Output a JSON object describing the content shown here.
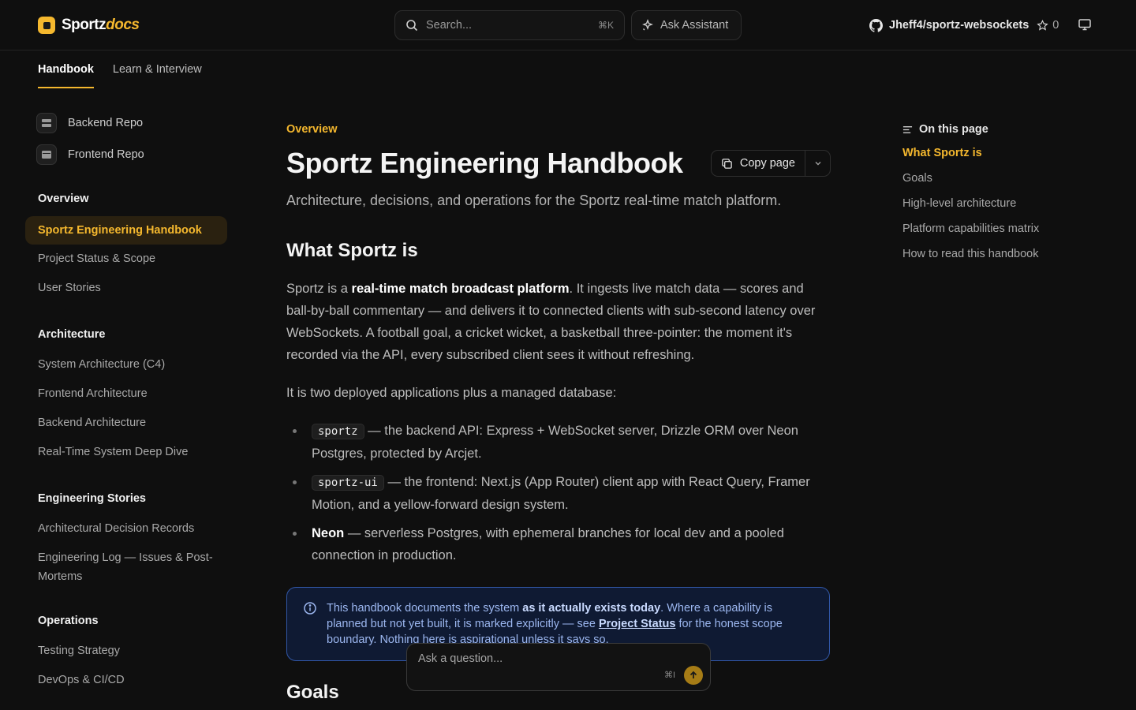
{
  "header": {
    "logo_text": "Sportz",
    "logo_accent": "docs",
    "search_placeholder": "Search...",
    "search_shortcut": "⌘K",
    "assistant_label": "Ask Assistant",
    "repo_name": "Jheff4/sportz-websockets",
    "repo_stars": "0"
  },
  "tabs": [
    {
      "label": "Handbook",
      "active": true
    },
    {
      "label": "Learn & Interview",
      "active": false
    }
  ],
  "sidebar": {
    "repos": [
      {
        "label": "Backend Repo"
      },
      {
        "label": "Frontend Repo"
      }
    ],
    "sections": [
      {
        "title": "Overview",
        "items": [
          "Sportz Engineering Handbook",
          "Project Status & Scope",
          "User Stories"
        ]
      },
      {
        "title": "Architecture",
        "items": [
          "System Architecture (C4)",
          "Frontend Architecture",
          "Backend Architecture",
          "Real-Time System Deep Dive"
        ]
      },
      {
        "title": "Engineering Stories",
        "items": [
          "Architectural Decision Records",
          "Engineering Log — Issues & Post-Mortems"
        ]
      },
      {
        "title": "Operations",
        "items": [
          "Testing Strategy",
          "DevOps & CI/CD"
        ]
      }
    ],
    "active_item": "Sportz Engineering Handbook"
  },
  "main": {
    "eyebrow": "Overview",
    "title": "Sportz Engineering Handbook",
    "copy_label": "Copy page",
    "subtitle": "Architecture, decisions, and operations for the Sportz real-time match platform.",
    "h2_what": "What Sportz is",
    "p1_a": "Sportz is a ",
    "p1_strong": "real-time match broadcast platform",
    "p1_b": ". It ingests live match data — scores and ball-by-ball commentary — and delivers it to connected clients with sub-second latency over WebSockets. A football goal, a cricket wicket, a basketball three-pointer: the moment it's recorded via the API, every subscribed client sees it without refreshing.",
    "p2": "It is two deployed applications plus a managed database:",
    "bullets": [
      {
        "code": "sportz",
        "text": " — the backend API: Express + WebSocket server, Drizzle ORM over Neon Postgres, protected by Arcjet."
      },
      {
        "code": "sportz-ui",
        "text": " — the frontend: Next.js (App Router) client app with React Query, Framer Motion, and a yellow-forward design system."
      },
      {
        "strong": "Neon",
        "text": " — serverless Postgres, with ephemeral branches for local dev and a pooled connection in production."
      }
    ],
    "callout": {
      "a": "This handbook documents the system ",
      "strong": "as it actually exists today",
      "b": ". Where a capability is planned but not yet built, it is marked explicitly — see ",
      "link": "Project Status",
      "c": " for the honest scope boundary. Nothing here is aspirational unless it says so."
    },
    "h2_goals": "Goals"
  },
  "askbox": {
    "placeholder": "Ask a question...",
    "shortcut": "⌘I"
  },
  "toc": {
    "title": "On this page",
    "items": [
      "What Sportz is",
      "Goals",
      "High-level architecture",
      "Platform capabilities matrix",
      "How to read this handbook"
    ],
    "active": "What Sportz is"
  },
  "colors": {
    "accent": "#f5b82e",
    "background": "#0f0f0f",
    "callout_border": "#3157a8"
  }
}
